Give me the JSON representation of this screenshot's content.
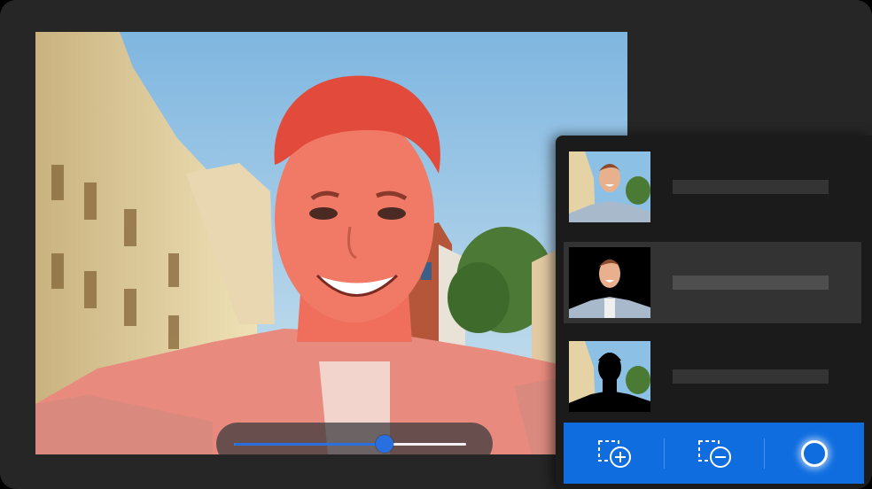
{
  "canvas": {
    "image": "selfie-photo",
    "mask_overlay_color": "#ff5a4e",
    "slider": {
      "value_fraction": 0.65,
      "accent_color": "#2a6fe0"
    }
  },
  "panel": {
    "layers": [
      {
        "thumbnail": "original-photo",
        "selected": false
      },
      {
        "thumbnail": "subject-on-black",
        "selected": true
      },
      {
        "thumbnail": "subject-silhouette",
        "selected": false
      }
    ],
    "toolbar": {
      "color": "#0f6de0",
      "tools": [
        {
          "icon": "add-selection-icon"
        },
        {
          "icon": "subtract-selection-icon"
        },
        {
          "icon": "brush-circle-icon"
        }
      ]
    }
  }
}
